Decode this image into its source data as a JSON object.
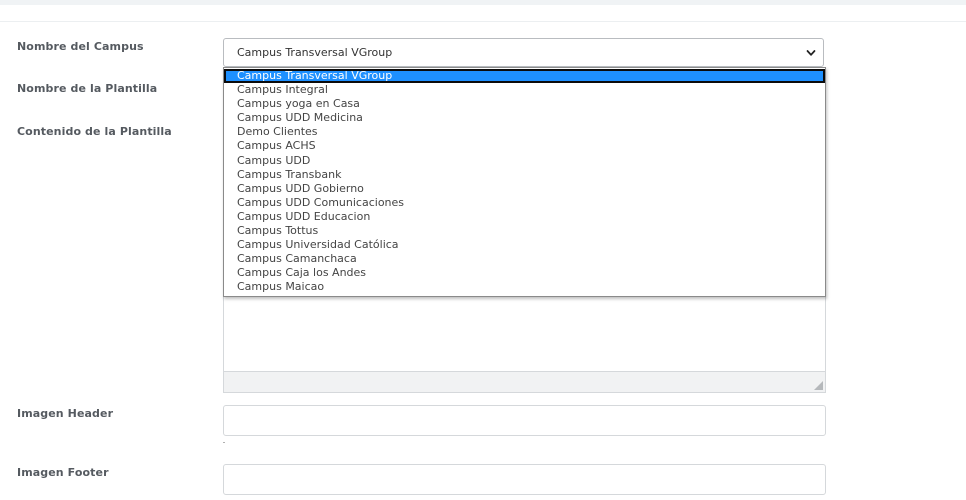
{
  "form": {
    "campus_label": "Nombre del Campus",
    "template_name_label": "Nombre de la Plantilla",
    "template_content_label": "Contenido de la Plantilla",
    "header_image_label": "Imagen Header",
    "footer_image_label": "Imagen Footer",
    "campus_select": {
      "selected_value": "Campus Transversal VGroup",
      "options": [
        "Campus Transversal VGroup",
        "Campus Integral",
        "Campus yoga en Casa",
        "Campus UDD Medicina",
        "Demo Clientes",
        "Campus ACHS",
        "Campus UDD",
        "Campus Transbank",
        "Campus UDD Gobierno",
        "Campus UDD Comunicaciones",
        "Campus UDD Educacion",
        "Campus Tottus",
        "Campus Universidad Católica",
        "Campus Camanchaca",
        "Campus Caja los Andes",
        "Campus Maicao"
      ],
      "highlighted_index": 0
    }
  },
  "icons": {
    "select_arrow": "chevron-down-icon",
    "textarea_resize": "resize-grip-icon"
  },
  "colors": {
    "highlight": "#1e90ff",
    "label_text": "#555a60",
    "border": "#d5d8db"
  }
}
